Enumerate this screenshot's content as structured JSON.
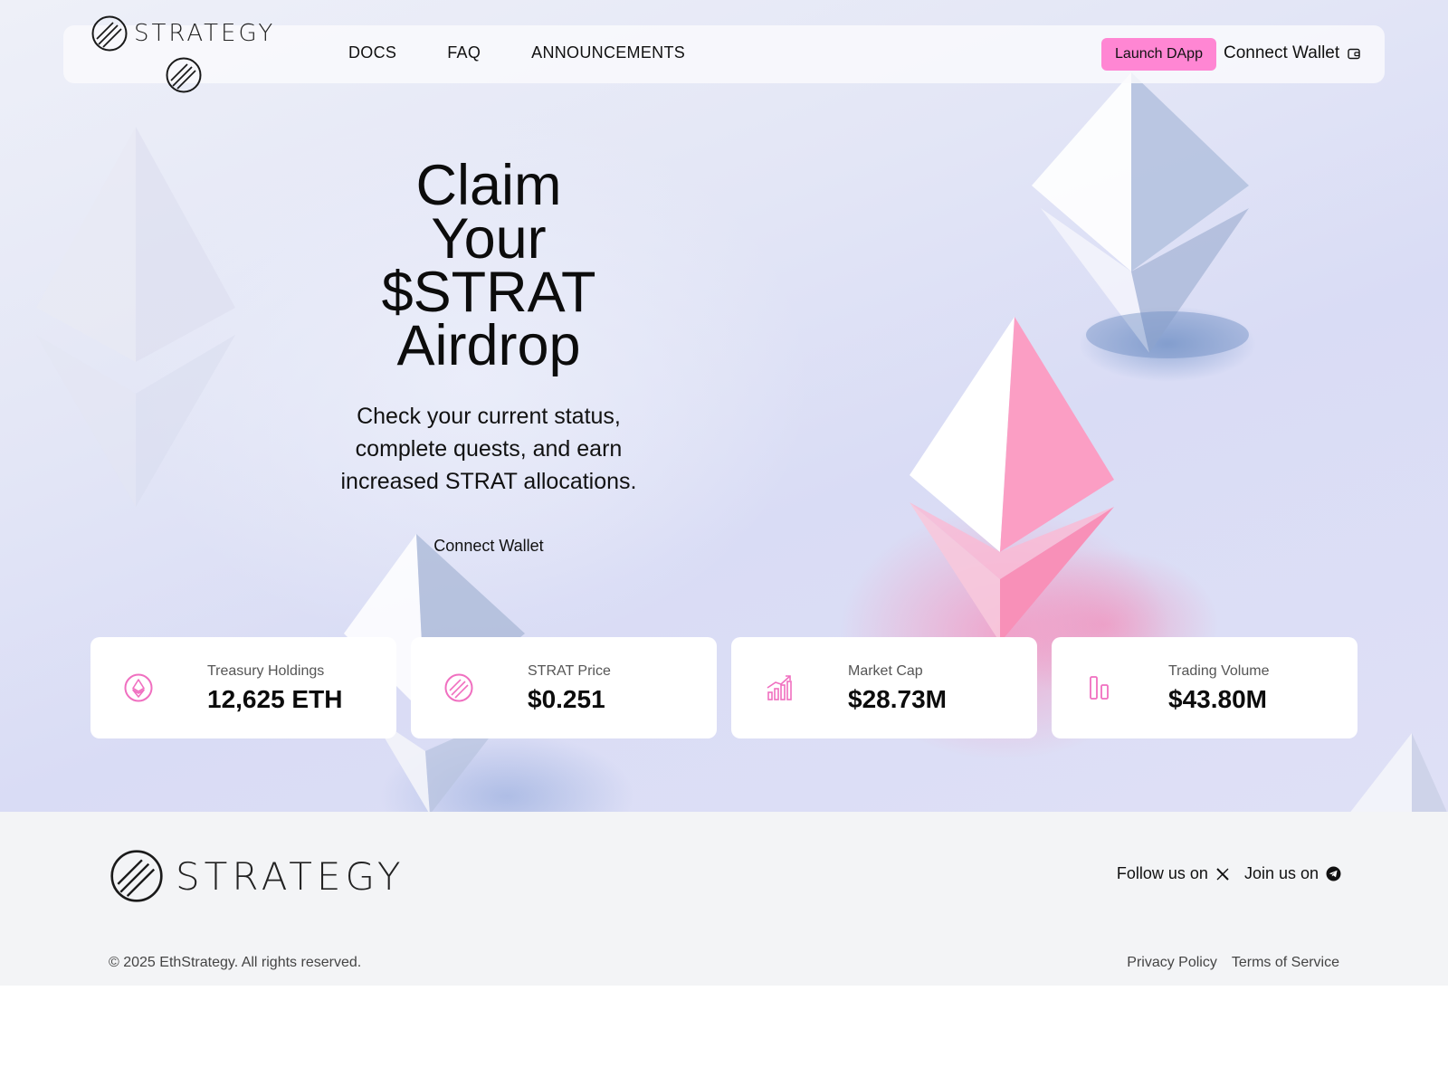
{
  "brand": {
    "name": "STRATEGY"
  },
  "nav": {
    "links": [
      "DOCS",
      "FAQ",
      "ANNOUNCEMENTS"
    ],
    "launch_label": "Launch DApp",
    "connect_label": "Connect Wallet"
  },
  "hero": {
    "title_lines": [
      "Claim",
      "Your",
      "$STRAT",
      "Airdrop"
    ],
    "subtitle": "Check your current status, complete quests, and earn increased STRAT allocations.",
    "connect_label": "Connect Wallet"
  },
  "stats": [
    {
      "label": "Treasury Holdings",
      "value": "12,625 ETH",
      "icon": "ethereum-coin-icon"
    },
    {
      "label": "STRAT Price",
      "value": "$0.251",
      "icon": "strat-coin-icon"
    },
    {
      "label": "Market Cap",
      "value": "$28.73M",
      "icon": "growth-chart-icon"
    },
    {
      "label": "Trading Volume",
      "value": "$43.80M",
      "icon": "volume-bars-icon"
    }
  ],
  "footer": {
    "follow_label": "Follow us on",
    "join_label": "Join us on",
    "copyright": "© 2025 EthStrategy. All rights reserved.",
    "privacy_label": "Privacy Policy",
    "terms_label": "Terms of Service"
  },
  "colors": {
    "accent_pink": "#ff86d3",
    "icon_pink": "#f06fc0",
    "footer_bg": "#f3f4f6"
  }
}
